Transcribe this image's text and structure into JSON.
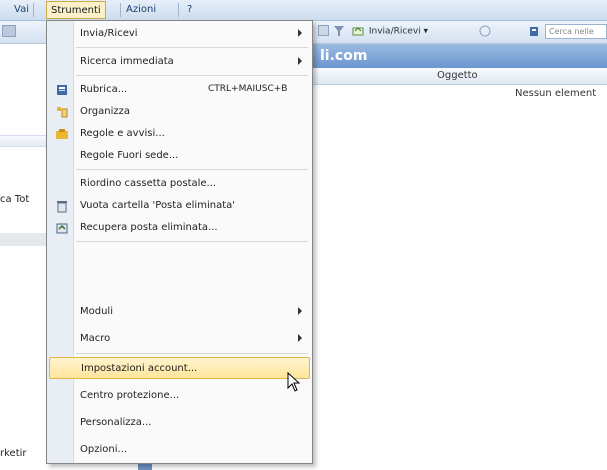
{
  "menubar": {
    "items": [
      {
        "label": "Vai"
      },
      {
        "label": "Strumenti"
      },
      {
        "label": "Azioni"
      },
      {
        "label": "?"
      }
    ]
  },
  "toolbar": {
    "invia_ricevi": "Invia/Ricevi",
    "search_placeholder": "Cerca nelle"
  },
  "header": {
    "title": "li.com"
  },
  "columns": {
    "subject": "Oggetto"
  },
  "main": {
    "empty_message": "Nessun element"
  },
  "left_pane": {
    "fragment_1": "ca Tot",
    "fragment_2": "rketir"
  },
  "menu": {
    "items": [
      {
        "label": "Invia/Ricevi",
        "icon": "none"
      },
      {
        "label": "Ricerca immediata",
        "icon": "none"
      },
      {
        "label": "Rubrica...",
        "shortcut": "CTRL+MAIUSC+B",
        "icon": "address-book-icon"
      },
      {
        "label": "Organizza",
        "icon": "organize-icon"
      },
      {
        "label": "Regole e avvisi...",
        "icon": "rules-icon"
      },
      {
        "label": "Regole Fuori sede...",
        "icon": "none"
      },
      {
        "label": "Riordino cassetta postale...",
        "icon": "none"
      },
      {
        "label": "Vuota cartella 'Posta eliminata'",
        "icon": "empty-trash-icon"
      },
      {
        "label": "Recupera posta eliminata...",
        "icon": "recover-mail-icon"
      },
      {
        "label": "Moduli",
        "icon": "none"
      },
      {
        "label": "Macro",
        "icon": "none"
      },
      {
        "label": "Impostazioni account...",
        "icon": "none"
      },
      {
        "label": "Centro protezione...",
        "icon": "none"
      },
      {
        "label": "Personalizza...",
        "icon": "none"
      },
      {
        "label": "Opzioni...",
        "icon": "none"
      }
    ]
  },
  "colors": {
    "accent_header": "#6c95cf",
    "highlight": "#fde59a"
  }
}
